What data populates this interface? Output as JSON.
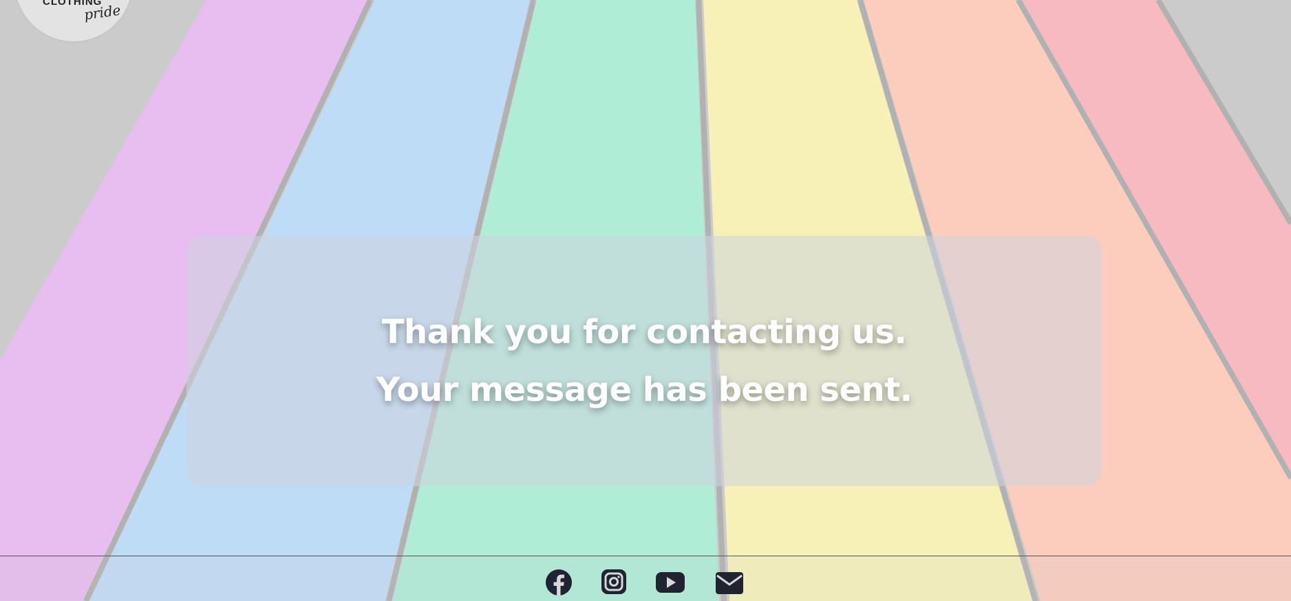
{
  "logo": {
    "wordmark": "CLOTHING",
    "script": "pride"
  },
  "message": {
    "line1": "Thank you for contacting us.",
    "line2": "Your message has been sent."
  },
  "footer": {
    "social_links": [
      {
        "name": "facebook-icon",
        "label": "Facebook"
      },
      {
        "name": "instagram-icon",
        "label": "Instagram"
      },
      {
        "name": "youtube-icon",
        "label": "YouTube"
      },
      {
        "name": "email-icon",
        "label": "Email"
      }
    ]
  },
  "colors": {
    "stripe_violet": "#e8b8ee",
    "stripe_blue": "#b9d9f8",
    "stripe_green": "#a8ecd3",
    "stripe_yellow": "#f8f1b0",
    "stripe_orange": "#fcc9b6",
    "stripe_red": "#f9b4bb",
    "asphalt": "#c7c7c7",
    "icon_color": "#1f2430",
    "text_color": "#ffffff"
  }
}
